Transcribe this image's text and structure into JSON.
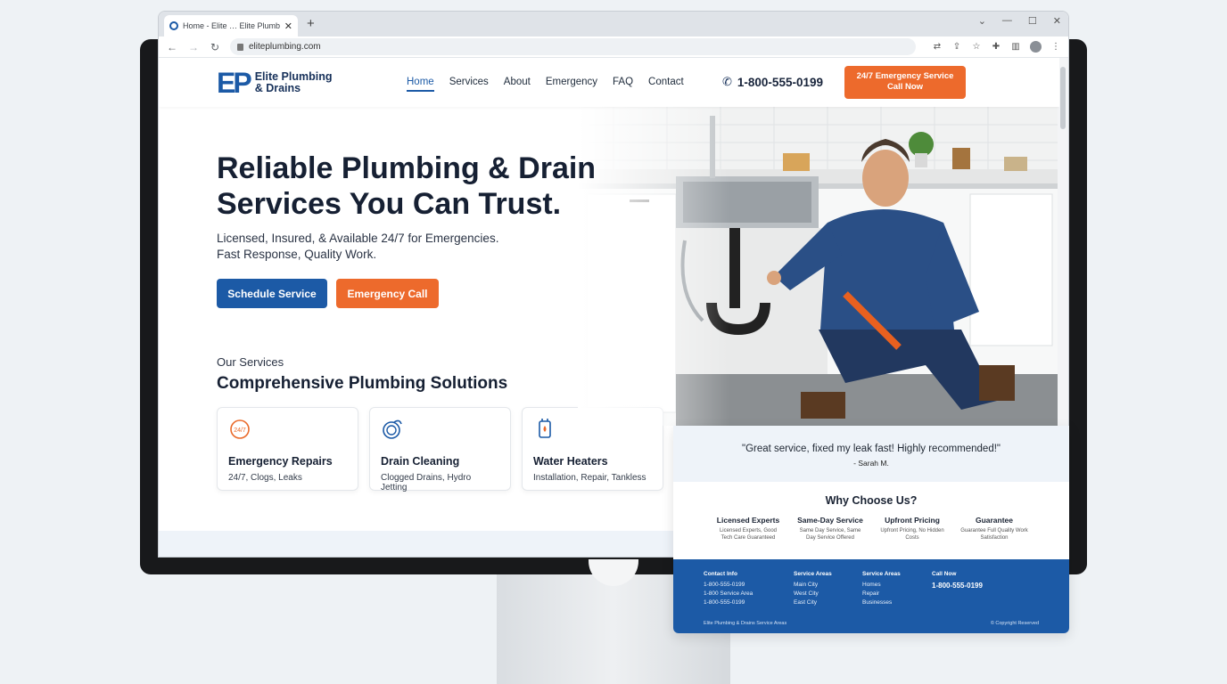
{
  "browser": {
    "tab_title": "Home - Elite … Elite Plumbing",
    "url": "eliteplumbing.com",
    "new_tab": "+",
    "close": "✕"
  },
  "site": {
    "logo_mark_left": "E",
    "logo_mark_right": "P",
    "logo_line1": "Elite Plumbing",
    "logo_line2": "& Drains",
    "nav": [
      "Home",
      "Services",
      "About",
      "Emergency",
      "FAQ",
      "Contact"
    ],
    "nav_active": "Home",
    "phone": "1-800-555-0199",
    "cta_line1": "24/7 Emergency Service",
    "cta_line2": "Call Now",
    "hero_title": "Reliable Plumbing & Drain Services You Can Trust.",
    "hero_sub_line1": "Licensed, Insured, & Available 24/7 for Emergencies.",
    "hero_sub_line2": "Fast Response, Quality Work.",
    "btn_schedule": "Schedule Service",
    "btn_emergency": "Emergency Call",
    "eyebrow": "Our Services",
    "section_title": "Comprehensive Plumbing Solutions",
    "cards": [
      {
        "title": "Emergency Repairs",
        "desc": "24/7, Clogs, Leaks",
        "icon_label": "24/7"
      },
      {
        "title": "Drain Cleaning",
        "desc": "Clogged Drains, Hydro Jetting"
      },
      {
        "title": "Water Heaters",
        "desc": "Installation, Repair, Tankless"
      }
    ]
  },
  "panel": {
    "quote": "\"Great service, fixed my leak fast! Highly recommended!\"",
    "author": "- Sarah M.",
    "why_title": "Why Choose Us?",
    "why": [
      {
        "title": "Licensed Experts",
        "desc": "Licensed Experts, Good Tech Care Guaranteed"
      },
      {
        "title": "Same-Day Service",
        "desc": "Same Day Service, Same Day Service Offered"
      },
      {
        "title": "Upfront Pricing",
        "desc": "Upfront Pricing, No Hidden Costs"
      },
      {
        "title": "Guarantee",
        "desc": "Guarantee Full Quality Work Satisfaction"
      }
    ],
    "footer": {
      "contact_title": "Contact Info",
      "contact_rows": [
        "1-800-555-0199",
        "1-800 Service Area",
        "1-800-555-0199"
      ],
      "services_title": "Service Areas",
      "services_rows": [
        "Main City",
        "West City",
        "East City"
      ],
      "areas_title": "Service Areas",
      "areas_rows": [
        "Homes",
        "Repair",
        "Businesses"
      ],
      "call_title": "Call Now",
      "call_number": "1-800-555-0199",
      "bottom_left": "Elite Plumbing & Drains Service Areas",
      "bottom_right": "© Copyright Reserved"
    }
  },
  "colors": {
    "brand_blue": "#1c5aa6",
    "brand_orange": "#ed6a2c",
    "text_dark": "#162033"
  }
}
